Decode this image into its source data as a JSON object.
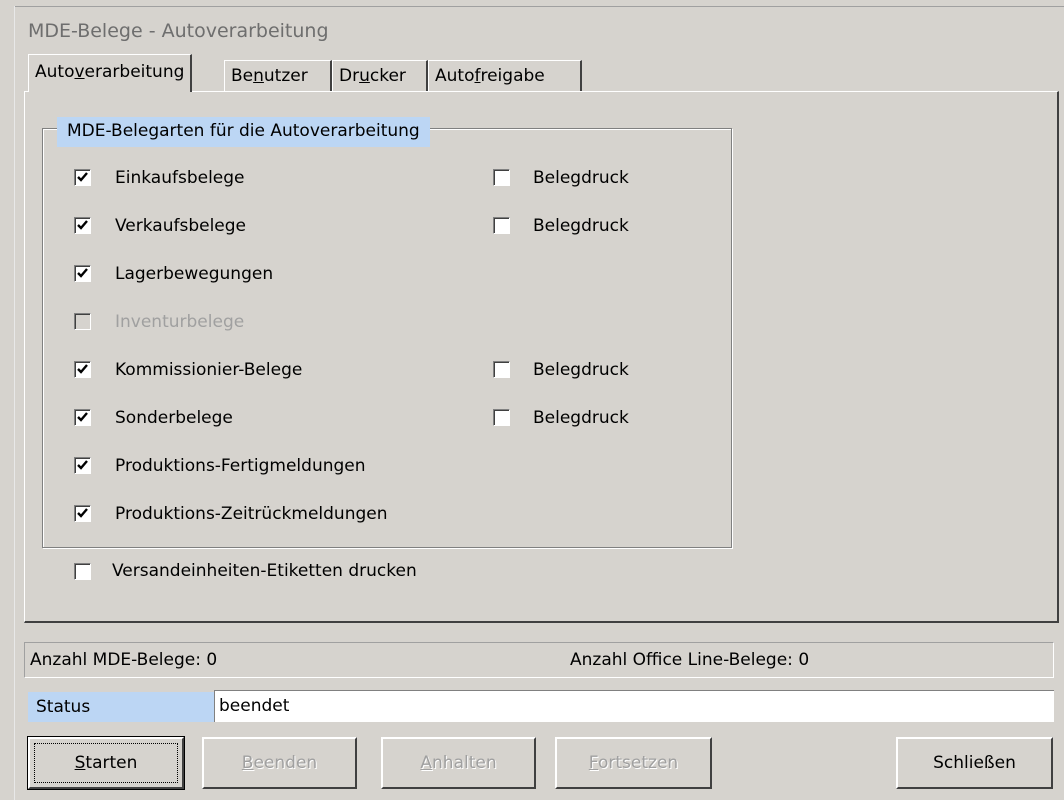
{
  "window": {
    "title": "MDE-Belege - Autoverarbeitung"
  },
  "tabs": [
    {
      "label_pre": "Auto",
      "mnemonic": "v",
      "label_post": "erarbeitung",
      "active": true
    },
    {
      "label_pre": "Be",
      "mnemonic": "n",
      "label_post": "utzer",
      "active": false
    },
    {
      "label_pre": "Dr",
      "mnemonic": "u",
      "label_post": "cker",
      "active": false
    },
    {
      "label_pre": "Auto",
      "mnemonic": "f",
      "label_post": "reigabe",
      "active": false
    }
  ],
  "group": {
    "title": "MDE-Belegarten für die Autoverarbeitung",
    "items": [
      {
        "label": "Einkaufsbelege",
        "checked": true,
        "disabled": false,
        "print_label": "Belegdruck",
        "print_checked": false
      },
      {
        "label": "Verkaufsbelege",
        "checked": true,
        "disabled": false,
        "print_label": "Belegdruck",
        "print_checked": false
      },
      {
        "label": "Lagerbewegungen",
        "checked": true,
        "disabled": false
      },
      {
        "label": "Inventurbelege",
        "checked": false,
        "disabled": true
      },
      {
        "label": "Kommissionier-Belege",
        "checked": true,
        "disabled": false,
        "print_label": "Belegdruck",
        "print_checked": false
      },
      {
        "label": "Sonderbelege",
        "checked": true,
        "disabled": false,
        "print_label": "Belegdruck",
        "print_checked": false
      },
      {
        "label": "Produktions-Fertigmeldungen",
        "checked": true,
        "disabled": false
      },
      {
        "label": "Produktions-Zeitrückmeldungen",
        "checked": true,
        "disabled": false
      }
    ]
  },
  "labels_option": {
    "label": "Versandeinheiten-Etiketten drucken",
    "checked": false
  },
  "counts": {
    "mde": "Anzahl MDE-Belege: 0",
    "office_line": "Anzahl Office Line-Belege: 0"
  },
  "status": {
    "label": "Status",
    "value": "beendet"
  },
  "buttons": [
    {
      "label_pre": "",
      "mnemonic": "S",
      "label_post": "tarten",
      "disabled": false,
      "default": true
    },
    {
      "label_pre": "",
      "mnemonic": "B",
      "label_post": "eenden",
      "disabled": true,
      "default": false
    },
    {
      "label_pre": "",
      "mnemonic": "A",
      "label_post": "nhalten",
      "disabled": true,
      "default": false
    },
    {
      "label_pre": "",
      "mnemonic": "F",
      "label_post": "ortsetzen",
      "disabled": true,
      "default": false
    },
    {
      "label": "Schließen",
      "disabled": false,
      "default": false
    }
  ],
  "colors": {
    "face": "#d6d3ce",
    "highlight_label_bg": "#bcd6f4",
    "disabled_text": "#a0a0a0"
  }
}
